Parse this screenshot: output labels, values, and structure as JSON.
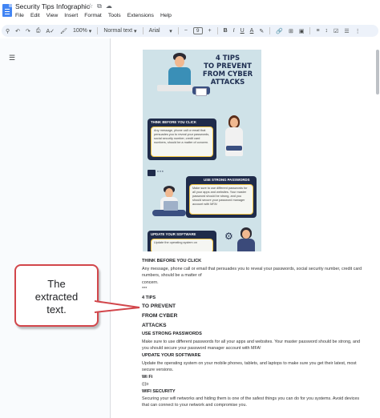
{
  "window": {
    "title": "Security Tips Infographic",
    "title_icons": [
      "star-icon",
      "move-icon",
      "cloud-icon"
    ]
  },
  "menu": [
    "File",
    "Edit",
    "View",
    "Insert",
    "Format",
    "Tools",
    "Extensions",
    "Help"
  ],
  "toolbar": {
    "zoom": "100%",
    "style": "Normal text",
    "font": "Arial",
    "minus": "−",
    "font_size": "9",
    "plus": "+",
    "bold": "B",
    "italic": "I",
    "underline": "U",
    "text_color": "A"
  },
  "infographic": {
    "title_lines": [
      "4 TIPS",
      "TO PREVENT",
      "FROM CYBER",
      "ATTACKS"
    ],
    "card1_label": "THINK BEFORE YOU CLICK",
    "card1_body": "Any message, phone call or email that persuades you to reveal your passwords, social security number, credit card numbers, should be a matter of concern.",
    "card2_label": "USE STRONG PASSWORDS",
    "card2_body": "Make sure to use different passwords for all your apps and websites. Your master password should be strong, and you should secure your password manager account with MFA!",
    "card3_label": "UPDATE YOUR SOFTWARE",
    "card3_body": "Update the operating system on"
  },
  "extracted": {
    "l1": "THINK BEFORE YOU CLICK",
    "l2": "Any message, phone call or email that persuades you to reveal your passwords, social security number, credit card",
    "l3": "numbers, should be a matter of",
    "l4": "concern.",
    "l5": "***",
    "l6": "4 TIPS",
    "l7": "TO PREVENT",
    "l8": "FROM CYBER",
    "l9": "ATTACKS",
    "l10": "USE STRONG PASSWORDS",
    "l11": "Make sure to use different passwords for all your apps and websites. Your master password should be strong, and",
    "l12": "you should secure your password manager account with MFA!",
    "l13": "UPDATE YOUR SOFTWARE",
    "l14": "Update the operating system on your mobile phones, tablets, and laptops to make sure you get their latest, most",
    "l15": "secure versions.",
    "l16": "Wi Fi",
    "l17": "(((o",
    "l18": "WIFI SECURITY",
    "l19": "Securing your wifi networks and hiding them is one of the safest things you can do for you systems. Avoid devices",
    "l20": "that can connect to your network and compromise you."
  },
  "callout": {
    "text_lines": [
      "The",
      "extracted",
      "text."
    ]
  },
  "colors": {
    "accent": "#4285f4",
    "callout_border": "#d2464b",
    "infographic_bg": "#cfe2e8",
    "card_dark": "#1f2b4a",
    "card_border": "#f3c53f"
  }
}
